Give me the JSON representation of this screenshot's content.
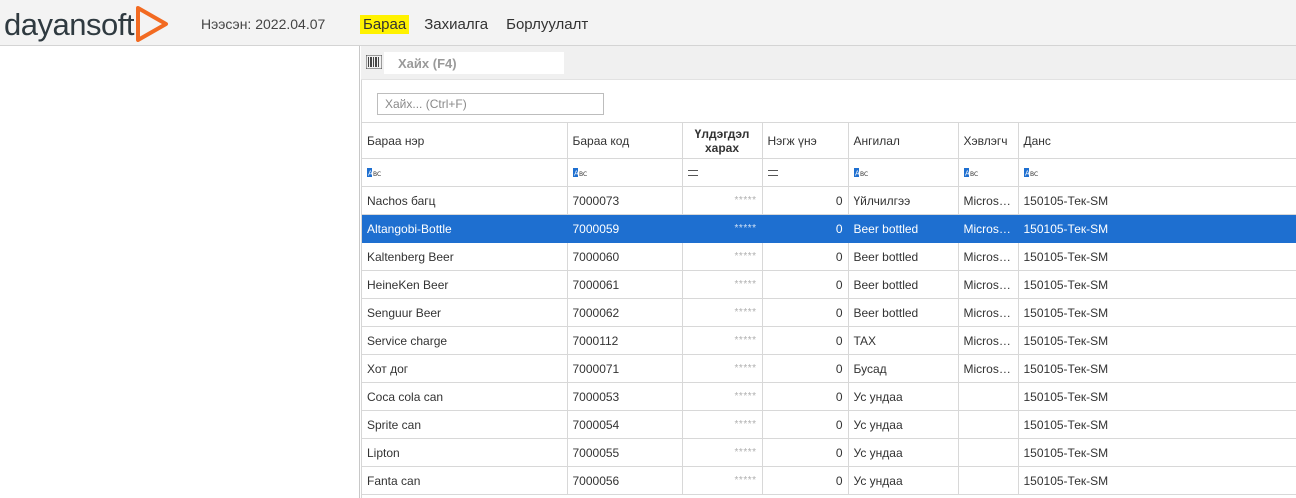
{
  "header": {
    "logo_text": "dayansoft",
    "date_label": "Нээсэн: 2022.04.07",
    "brand_color": "#f26a21",
    "nav": [
      {
        "label": "Бараа",
        "active": true
      },
      {
        "label": "Захиалга",
        "active": false
      },
      {
        "label": "Борлуулалт",
        "active": false
      }
    ]
  },
  "search": {
    "top_placeholder": "Хайх (F4)",
    "filter_placeholder": "Хайх... (Ctrl+F)"
  },
  "grid": {
    "columns": [
      "Бараа нэр",
      "Бараа код",
      "Үлдэгдэл харах",
      "Нэгж үнэ",
      "Ангилал",
      "Хэвлэгч",
      "Данс"
    ],
    "filter_icons": [
      "abc-icon",
      "abc-icon",
      "equals-icon",
      "equals-icon",
      "abc-icon",
      "abc-icon",
      "abc-icon"
    ],
    "selected_color": "#1e6fd0",
    "rows": [
      {
        "name": "Nachos багц",
        "code": "7000073",
        "stock": "*****",
        "price": "0",
        "category": "Үйлчилгээ",
        "printer": "Microsoft Print to PDF",
        "account": "150105-Тек-SM",
        "selected": false
      },
      {
        "name": "Altangobi-Bottle",
        "code": "7000059",
        "stock": "*****",
        "price": "0",
        "category": "Beer bottled",
        "printer": "Microsoft Print to PDF",
        "account": "150105-Тек-SM",
        "selected": true
      },
      {
        "name": "Kaltenberg Beer",
        "code": "7000060",
        "stock": "*****",
        "price": "0",
        "category": "Beer bottled",
        "printer": "Microsoft Print to PDF",
        "account": "150105-Тек-SM",
        "selected": false
      },
      {
        "name": "HeineKen  Beer",
        "code": "7000061",
        "stock": "*****",
        "price": "0",
        "category": "Beer bottled",
        "printer": "Microsoft Print to PDF",
        "account": "150105-Тек-SM",
        "selected": false
      },
      {
        "name": "Senguur  Beer",
        "code": "7000062",
        "stock": "*****",
        "price": "0",
        "category": "Beer bottled",
        "printer": "Microsoft Print to PDF",
        "account": "150105-Тек-SM",
        "selected": false
      },
      {
        "name": "Service charge",
        "code": "7000112",
        "stock": "*****",
        "price": "0",
        "category": "TAX",
        "printer": "Microsoft Print to PDF",
        "account": "150105-Тек-SM",
        "selected": false
      },
      {
        "name": "Хот дог",
        "code": "7000071",
        "stock": "*****",
        "price": "0",
        "category": "Бусад",
        "printer": "Microsoft Print to PDF",
        "account": "150105-Тек-SM",
        "selected": false
      },
      {
        "name": "Coca cola can",
        "code": "7000053",
        "stock": "*****",
        "price": "0",
        "category": "Ус ундаа",
        "printer": "",
        "account": "150105-Тек-SM",
        "selected": false
      },
      {
        "name": "Sprite can",
        "code": "7000054",
        "stock": "*****",
        "price": "0",
        "category": "Ус ундаа",
        "printer": "",
        "account": "150105-Тек-SM",
        "selected": false
      },
      {
        "name": "Lipton",
        "code": "7000055",
        "stock": "*****",
        "price": "0",
        "category": "Ус ундаа",
        "printer": "",
        "account": "150105-Тек-SM",
        "selected": false
      },
      {
        "name": "Fanta can",
        "code": "7000056",
        "stock": "*****",
        "price": "0",
        "category": "Ус ундаа",
        "printer": "",
        "account": "150105-Тек-SM",
        "selected": false
      }
    ]
  }
}
